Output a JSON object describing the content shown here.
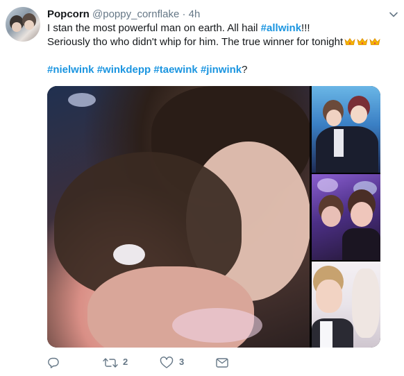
{
  "tweet": {
    "display_name": "Popcorn",
    "handle": "@poppy_cornflake",
    "separator": "·",
    "time": "4h",
    "text": {
      "line1_a": "I stan the most powerful man on earth. All hail ",
      "line1_hashtag": "#allwink",
      "line1_b": "!!!",
      "line2": "Seriously tho who didn't whip for him. The true winner for tonight",
      "line3_hashtags": [
        "#nielwink",
        "#winkdepp",
        "#taewink",
        "#jinwink"
      ],
      "line3_end": "?"
    },
    "crown_count": 3,
    "media_count": 4,
    "actions": {
      "reply_count": "",
      "retweet_count": "2",
      "like_count": "3"
    }
  },
  "colors": {
    "text": "#14171a",
    "secondary": "#657786",
    "hashtag": "#1b95e0",
    "crown": "#f5b400"
  },
  "icons": [
    "avatar",
    "chevron-down-icon",
    "crown-icon",
    "reply-icon",
    "retweet-icon",
    "like-icon",
    "dm-icon"
  ]
}
